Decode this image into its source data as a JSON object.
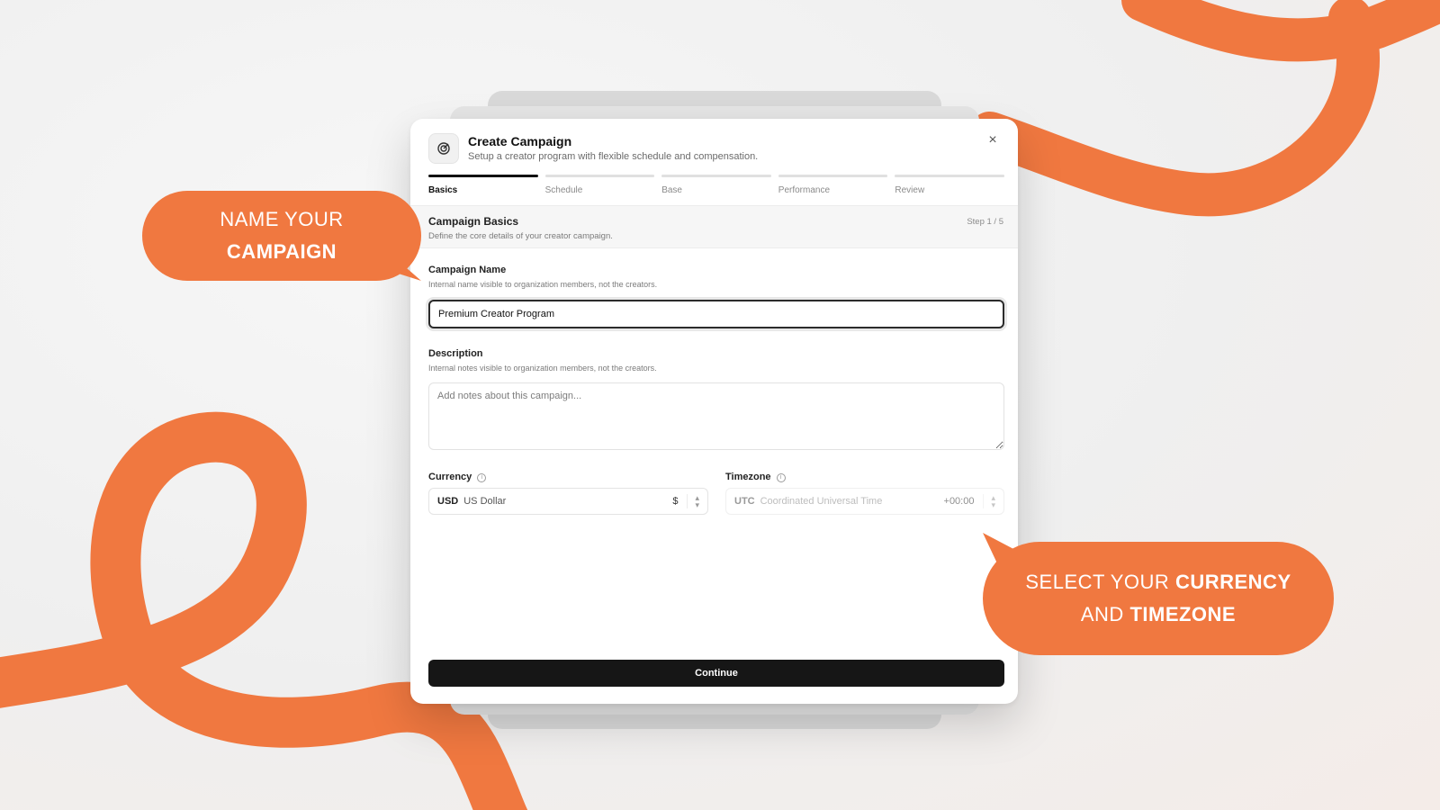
{
  "colors": {
    "accent": "#f07840",
    "primary_button": "#161616",
    "step_active": "#111111",
    "step_inactive": "#e0e0e0"
  },
  "modal": {
    "title": "Create Campaign",
    "subtitle": "Setup a creator program with flexible schedule and compensation.",
    "header_icon": "target-icon",
    "close_icon": "close-icon",
    "steps": [
      {
        "label": "Basics",
        "active": true
      },
      {
        "label": "Schedule",
        "active": false
      },
      {
        "label": "Base",
        "active": false
      },
      {
        "label": "Performance",
        "active": false
      },
      {
        "label": "Review",
        "active": false
      }
    ],
    "section": {
      "title": "Campaign Basics",
      "subtitle": "Define the core details of your creator campaign.",
      "step_indicator": "Step 1 / 5"
    },
    "campaign_name": {
      "label": "Campaign Name",
      "help": "Internal name visible to organization members, not the creators.",
      "value": "Premium Creator Program"
    },
    "description": {
      "label": "Description",
      "help": "Internal notes visible to organization members, not the creators.",
      "placeholder": "Add notes about this campaign..."
    },
    "currency": {
      "label": "Currency",
      "code": "USD",
      "name": "US Dollar",
      "symbol": "$"
    },
    "timezone": {
      "label": "Timezone",
      "code": "UTC",
      "name": "Coordinated Universal Time",
      "offset": "+00:00",
      "disabled": true
    },
    "continue_label": "Continue"
  },
  "callouts": {
    "left": {
      "line1": "NAME YOUR",
      "line2_bold": "CAMPAIGN"
    },
    "right": {
      "line1_plain": "SELECT YOUR ",
      "line1_bold": "CURRENCY",
      "line2_plain": "AND ",
      "line2_bold": "TIMEZONE"
    }
  }
}
